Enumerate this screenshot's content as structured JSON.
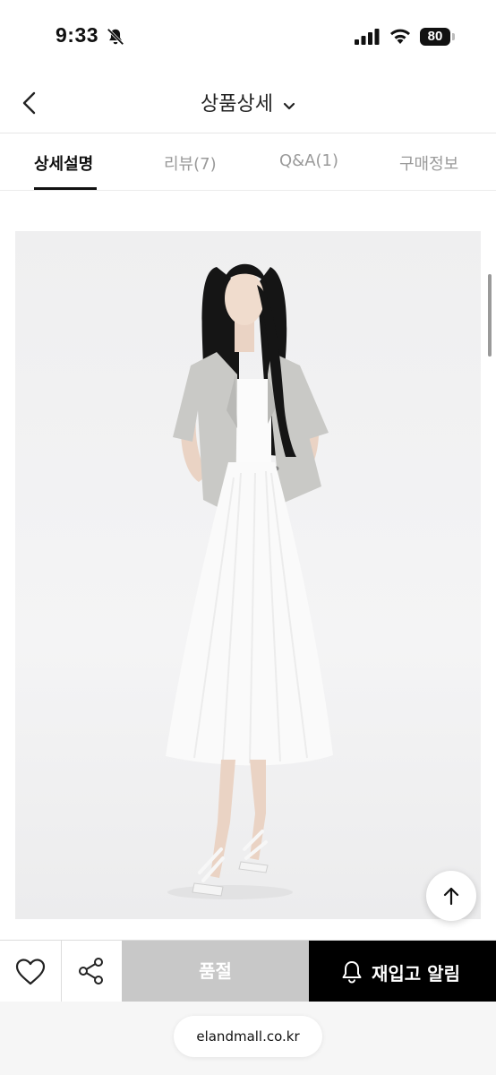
{
  "status_bar": {
    "time": "9:33",
    "battery": "80"
  },
  "header": {
    "title": "상품상세"
  },
  "tabs": [
    {
      "label": "상세설명"
    },
    {
      "label": "리뷰(7)"
    },
    {
      "label": "Q&A(1)"
    },
    {
      "label": "구매정보"
    }
  ],
  "bottom_bar": {
    "soldout_label": "품절",
    "restock_label": "재입고 알림"
  },
  "browser": {
    "url": "elandmall.co.kr"
  },
  "colors": {
    "accent": "#000000",
    "soldout": "#c8c8c8",
    "tab_inactive": "#9a9a9a"
  }
}
